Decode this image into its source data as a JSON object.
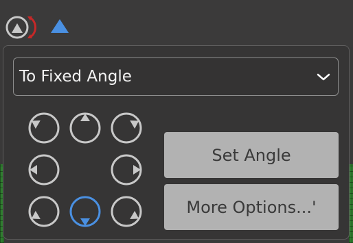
{
  "toolbar": {
    "icons": [
      "rotate-icon",
      "triangle-icon"
    ]
  },
  "colors": {
    "accent": "#4a90e2",
    "rotate_arrow": "#c62828",
    "dial_stroke": "#c8c8c8"
  },
  "panel": {
    "mode_select": {
      "value": "To Fixed Angle"
    },
    "angle_picker": {
      "selected": "bottom",
      "dials": [
        "top-left",
        "top",
        "top-right",
        "left",
        "right",
        "bottom-left",
        "bottom",
        "bottom-right"
      ]
    },
    "set_angle_label": "Set Angle",
    "more_options_label": "More Options...'"
  }
}
